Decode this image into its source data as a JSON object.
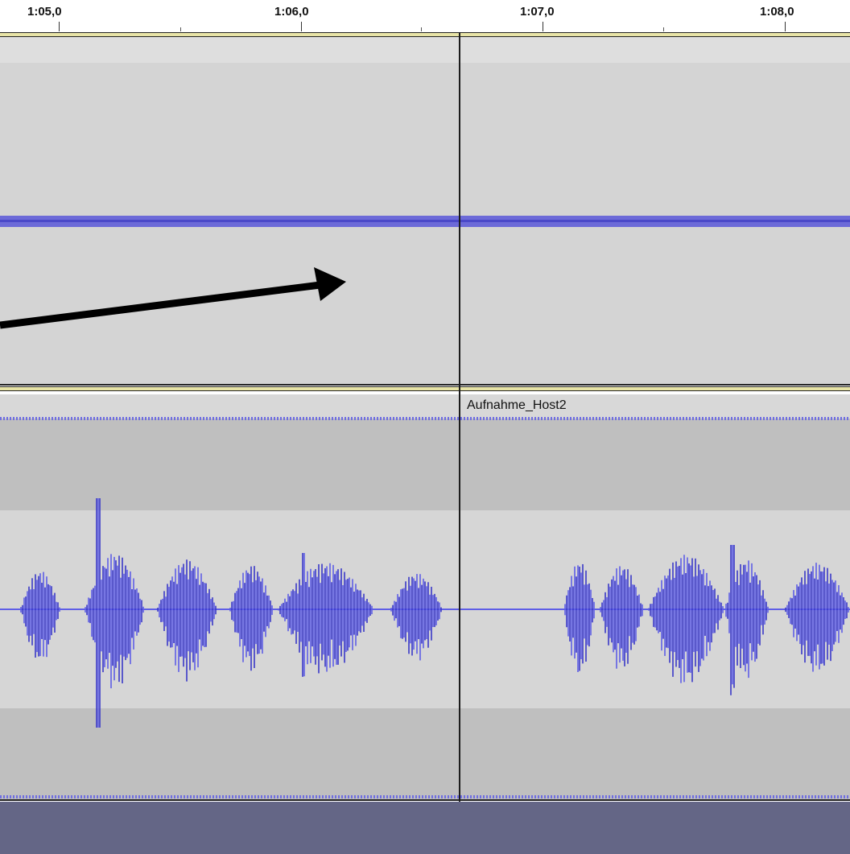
{
  "timeline": {
    "ticks": [
      "1:05,0",
      "1:06,0",
      "1:07,0",
      "1:08,0"
    ]
  },
  "tracks": {
    "track2": {
      "clip_name": "Aufnahme_Host2"
    }
  },
  "colors": {
    "waveform": "#5f5ee6",
    "waveform_dark": "#3a38c8",
    "cursor": "#1c1c1c",
    "track_background": "#d4d4d4",
    "below_area": "#646686"
  },
  "annotation": {
    "arrow_icon": "arrow-right-icon"
  }
}
